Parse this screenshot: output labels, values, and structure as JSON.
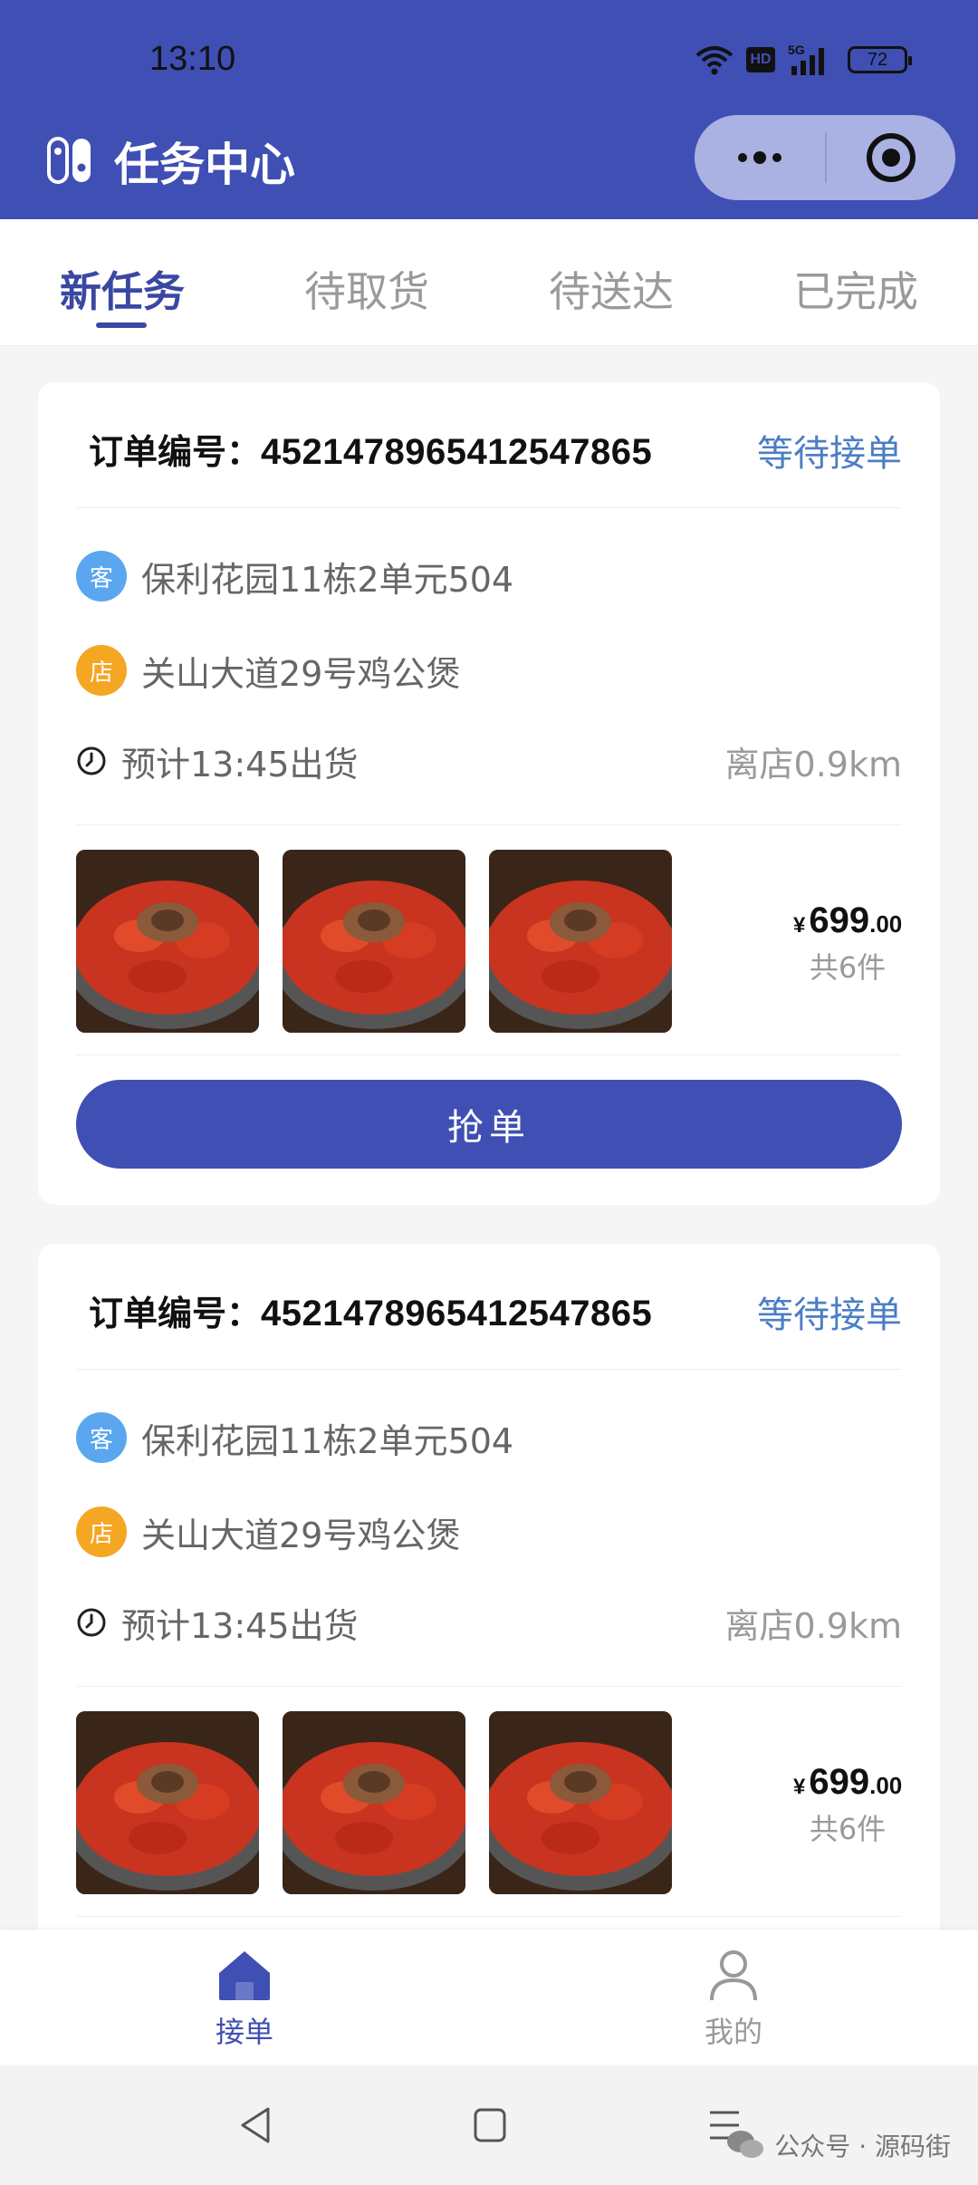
{
  "status_bar": {
    "time": "13:10",
    "hd": "HD",
    "network": "5G",
    "battery": "72"
  },
  "app": {
    "title": "任务中心"
  },
  "tabs": [
    {
      "label": "新任务",
      "active": true
    },
    {
      "label": "待取货",
      "active": false
    },
    {
      "label": "待送达",
      "active": false
    },
    {
      "label": "已完成",
      "active": false
    }
  ],
  "orders": [
    {
      "label": "订单编号：",
      "number": "4521478965412547865",
      "status": "等待接单",
      "customer_badge": "客",
      "customer_address": "保利花园11栋2单元504",
      "shop_badge": "店",
      "shop_address": "关山大道29号鸡公煲",
      "eta": "预计13:45出货",
      "distance": "离店0.9km",
      "price": {
        "currency": "¥",
        "int": "699",
        "dec": ".00"
      },
      "count": "共6件",
      "action": "抢单"
    },
    {
      "label": "订单编号：",
      "number": "4521478965412547865",
      "status": "等待接单",
      "customer_badge": "客",
      "customer_address": "保利花园11栋2单元504",
      "shop_badge": "店",
      "shop_address": "关山大道29号鸡公煲",
      "eta": "预计13:45出货",
      "distance": "离店0.9km",
      "price": {
        "currency": "¥",
        "int": "699",
        "dec": ".00"
      },
      "count": "共6件"
    }
  ],
  "bottom_nav": [
    {
      "label": "接单",
      "icon": "home-icon",
      "active": true
    },
    {
      "label": "我的",
      "icon": "user-icon",
      "active": false
    }
  ],
  "watermark": "公众号 · 源码街",
  "colors": {
    "primary": "#3f4fb3",
    "status": "#4c7ec6",
    "customer": "#5aa7ef",
    "shop": "#f5a623"
  }
}
